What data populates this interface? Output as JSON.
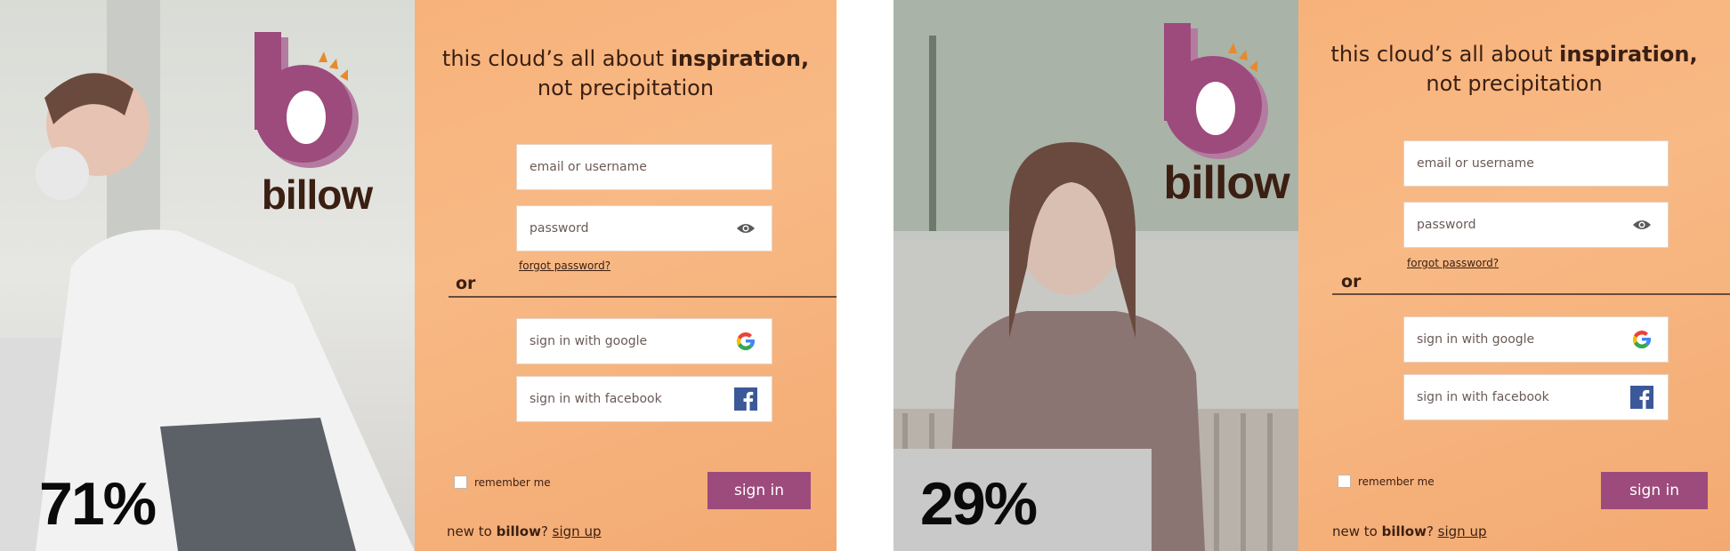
{
  "brand": {
    "name": "billow",
    "primary": "#9d4a7c",
    "secondary": "#b47ba0",
    "accent": "#e68a2e",
    "ink": "#3a1f12"
  },
  "panels": [
    {
      "percent": "71%",
      "tagline": {
        "pre": "this cloud’s all about ",
        "bold": "inspiration,",
        "line2": "not precipitation"
      },
      "email_placeholder": "email or username",
      "password_placeholder": "password",
      "forgot": "forgot password?",
      "or": "or",
      "google": "sign in with google",
      "facebook": "sign in with facebook",
      "remember": "remember me",
      "signin": "sign in",
      "newto": {
        "pre": "new to ",
        "brand": "billow",
        "mid": "? ",
        "link": "sign up"
      }
    },
    {
      "percent": "29%",
      "tagline": {
        "pre": "this cloud’s all about ",
        "bold": "inspiration,",
        "line2": "not precipitation"
      },
      "email_placeholder": "email or username",
      "password_placeholder": "password",
      "forgot": "forgot password?",
      "or": "or",
      "google": "sign in with google",
      "facebook": "sign in with facebook",
      "remember": "remember me",
      "signin": "sign in",
      "newto": {
        "pre": "new to ",
        "brand": "billow",
        "mid": "? ",
        "link": "sign up"
      }
    }
  ],
  "icons": {
    "eye": "eye-icon",
    "google": "google-icon",
    "facebook": "facebook-icon"
  }
}
